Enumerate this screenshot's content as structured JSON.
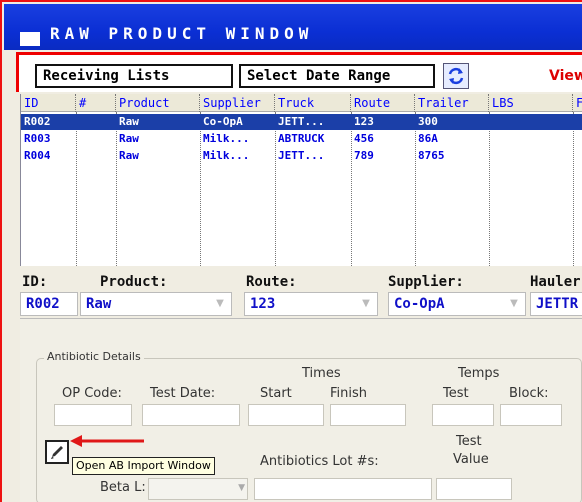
{
  "window": {
    "title": "RAW PRODUCT WINDOW"
  },
  "toolbar": {
    "receiving_lists": "Receiving Lists",
    "select_date_range": "Select Date Range",
    "view_label": "View"
  },
  "grid": {
    "columns": [
      "ID",
      "#",
      "Product",
      "Supplier",
      "Truck",
      "Route",
      "Trailer",
      "LBS",
      "F"
    ],
    "rows": [
      {
        "id": "R002",
        "num": "",
        "product": "Raw",
        "supplier": "Co-OpA",
        "truck": "JETT...",
        "route": "123",
        "trailer": "300",
        "lbs": "",
        "selected": true
      },
      {
        "id": "R003",
        "num": "",
        "product": "Raw",
        "supplier": "Milk...",
        "truck": "ABTRUCK",
        "route": "456",
        "trailer": "86A",
        "lbs": "",
        "selected": false
      },
      {
        "id": "R004",
        "num": "",
        "product": "Raw",
        "supplier": "Milk...",
        "truck": "JETT...",
        "route": "789",
        "trailer": "8765",
        "lbs": "",
        "selected": false
      }
    ]
  },
  "detail": {
    "id_label": "ID:",
    "id_value": "R002",
    "product_label": "Product:",
    "product_value": "Raw",
    "route_label": "Route:",
    "route_value": "123",
    "supplier_label": "Supplier:",
    "supplier_value": "Co-OpA",
    "hauler_label": "Hauler",
    "hauler_value": "JETTR"
  },
  "antibiotic": {
    "legend": "Antibiotic Details",
    "times": "Times",
    "temps": "Temps",
    "op_code": "OP Code:",
    "test_date": "Test Date:",
    "start": "Start",
    "finish": "Finish",
    "test": "Test",
    "block": "Block:",
    "test_value_line1": "Test",
    "test_value_line2": "Value",
    "lot_numbers": "Antibiotics Lot #s:",
    "beta_l": "Beta L:",
    "tooltip": "Open AB Import Window"
  },
  "colors": {
    "title_bar": "#0b2fd4",
    "selection": "#1b3fa8",
    "highlight": "#e11",
    "link_text": "#00d"
  }
}
